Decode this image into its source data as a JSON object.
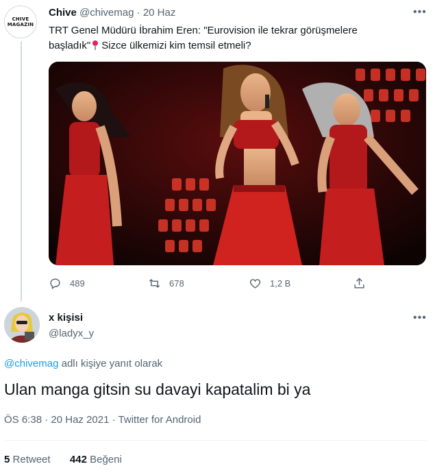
{
  "tweet": {
    "avatar_text": [
      "CHIVE",
      "MAGAZIN"
    ],
    "author_name": "Chive",
    "author_handle": "@chivemag",
    "separator": "·",
    "date": "20 Haz",
    "more_label": "•••",
    "text_line1": "TRT Genel Müdürü İbrahim Eren: \"Eurovision ile tekrar görüşmelere",
    "text_line2a": "başladık\"",
    "text_line2b": "Sizce ülkemizi kim temsil etmeli?",
    "pin_icon": "round-pushpin-icon",
    "replies": "489",
    "retweets": "678",
    "likes": "1,2 B"
  },
  "reply": {
    "author_name": "x kişisi",
    "author_handle": "@ladyx_y",
    "more_label": "•••",
    "reply_to_mention": "@chivemag",
    "reply_to_suffix": " adlı kişiye yanıt olarak",
    "text": "Ulan manga gitsin su davayi kapatalim bi ya",
    "time": "ÖS 6:38",
    "sep1": "·",
    "date": "20 Haz 2021",
    "sep2": "·",
    "source": "Twitter for Android",
    "retweet_count": "5",
    "retweet_label": "Retweet",
    "like_count": "442",
    "like_label": "Beğeni"
  },
  "colors": {
    "accent": "#1d9bf0",
    "muted": "#536471",
    "stage_red": "#c41e1e"
  }
}
